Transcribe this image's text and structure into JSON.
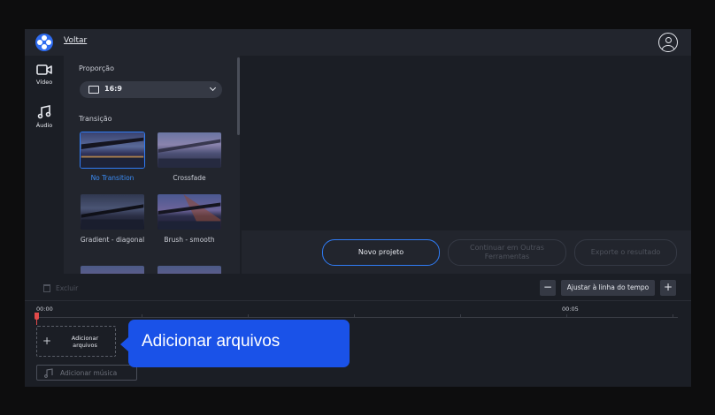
{
  "topbar": {
    "back_label": "Voltar"
  },
  "rail": {
    "items": [
      {
        "label": "Vídeo",
        "icon": "video-camera-icon"
      },
      {
        "label": "Áudio",
        "icon": "music-note-icon"
      }
    ]
  },
  "panel": {
    "aspect_section": "Proporção",
    "aspect_value": "16:9",
    "transition_section": "Transição",
    "transitions": [
      {
        "label": "No Transition",
        "selected": true
      },
      {
        "label": "Crossfade",
        "selected": false
      },
      {
        "label": "Gradient - diagonal",
        "selected": false
      },
      {
        "label": "Brush - smooth",
        "selected": false
      }
    ]
  },
  "actions": {
    "new_project": "Novo projeto",
    "continue": "Continuar em Outras Ferramentas",
    "export": "Exporte o resultado"
  },
  "timeline": {
    "delete_label": "Excluir",
    "zoom_out": "−",
    "fit_label": "Ajustar à linha do tempo",
    "zoom_in": "+",
    "time_start": "00:00",
    "time_mid": "00:05",
    "add_files_label": "Adicionar arquivos",
    "add_music_label": "Adicionar música"
  },
  "tooltip": {
    "text": "Adicionar arquivos"
  },
  "colors": {
    "accent": "#2f7cf6",
    "tooltip": "#1a52e8",
    "playhead": "#e24a4a"
  }
}
